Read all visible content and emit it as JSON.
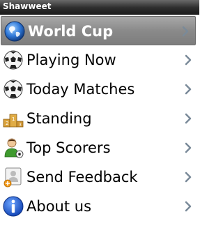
{
  "app": {
    "title": "Shawweet"
  },
  "menu": {
    "items": [
      {
        "label": "World Cup",
        "icon": "globe-icon",
        "selected": true
      },
      {
        "label": "Playing Now",
        "icon": "soccer-ball-icon"
      },
      {
        "label": "Today Matches",
        "icon": "soccer-ball-icon"
      },
      {
        "label": "Standing",
        "icon": "podium-icon"
      },
      {
        "label": "Top Scorers",
        "icon": "player-icon"
      },
      {
        "label": "Send Feedback",
        "icon": "feedback-icon"
      },
      {
        "label": "About us",
        "icon": "info-icon"
      }
    ]
  },
  "colors": {
    "titlebar": "#2e2e2e",
    "selected_row": "#8a8a8a",
    "chevron": "#7a8a99",
    "info_blue": "#1e5bd6"
  }
}
